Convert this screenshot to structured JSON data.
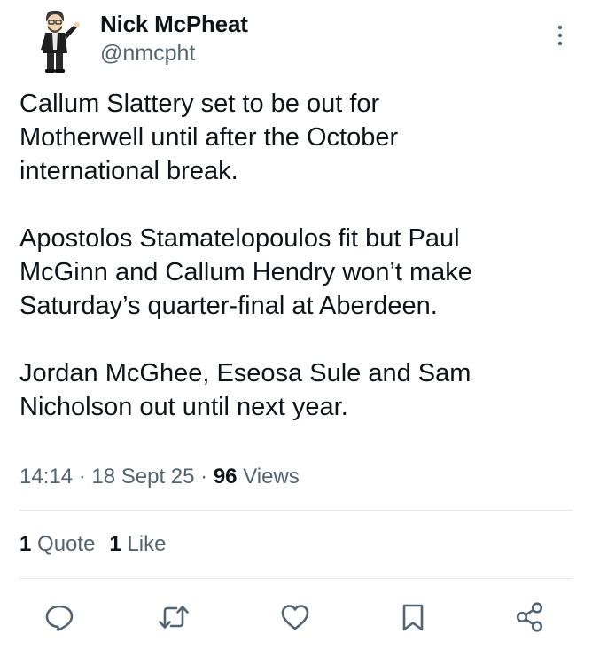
{
  "author": {
    "name": "Nick McPheat",
    "handle": "@nmcpht"
  },
  "tweet": {
    "text": "Callum Slattery set to be out for\nMotherwell until after the October\ninternational break.\n\nApostolos Stamatelopoulos fit but Paul\nMcGinn and Callum Hendry won’t make\nSaturday’s quarter-final at Aberdeen.\n\nJordan McGhee, Eseosa Sule and Sam\nNicholson out until next year."
  },
  "meta": {
    "time": "14:14",
    "separator": " · ",
    "date": "18 Sept 25",
    "views_count": "96",
    "views_label": "Views"
  },
  "stats": {
    "quotes_count": "1",
    "quotes_label": "Quote",
    "likes_count": "1",
    "likes_label": "Like"
  },
  "icons": {
    "more": "more-vertical-icon",
    "reply": "reply-icon",
    "repost": "repost-icon",
    "like": "heart-icon",
    "bookmark": "bookmark-icon",
    "share": "share-icon"
  },
  "colors": {
    "text": "#0f1419",
    "secondary": "#536471",
    "divider": "#e6e9ec"
  }
}
